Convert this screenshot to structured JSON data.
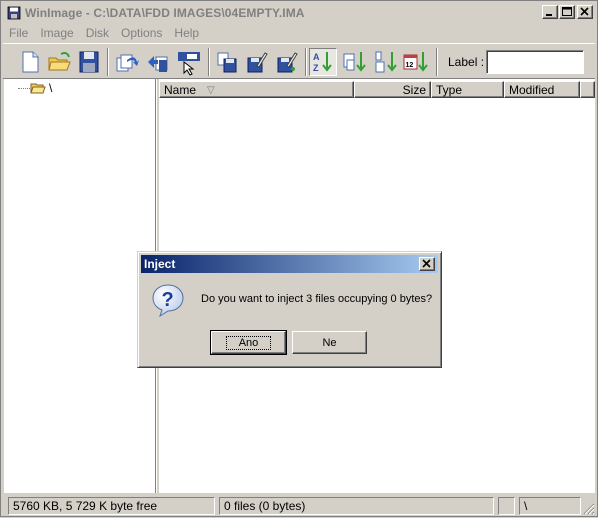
{
  "window": {
    "title": "WinImage - C:\\DATA\\FDD IMAGES\\04EMPTY.IMA"
  },
  "menu": [
    "File",
    "Image",
    "Disk",
    "Options",
    "Help"
  ],
  "toolbar": {
    "label_caption": "Label :",
    "label_value": "",
    "icons": [
      "new-icon",
      "open-icon",
      "save-icon",
      "extract-icon",
      "inject-icon",
      "view-icon",
      "copy-icon",
      "edit-icon",
      "edit-alt-icon",
      "sort-name-icon",
      "sort-type-icon",
      "sort-size-icon",
      "sort-date-icon"
    ]
  },
  "tree": {
    "root_label": "\\"
  },
  "list": {
    "columns": [
      "Name",
      "Size",
      "Type",
      "Modified"
    ]
  },
  "statusbar": {
    "disk_info": "5760 KB, 5 729 K byte free",
    "files_info": "0 files (0 bytes)",
    "path": "\\"
  },
  "dialog": {
    "title": "Inject",
    "message": "Do you want to inject 3 files occupying 0 bytes?",
    "yes_label": "Ano",
    "no_label": "Ne",
    "icon": "question-icon"
  }
}
